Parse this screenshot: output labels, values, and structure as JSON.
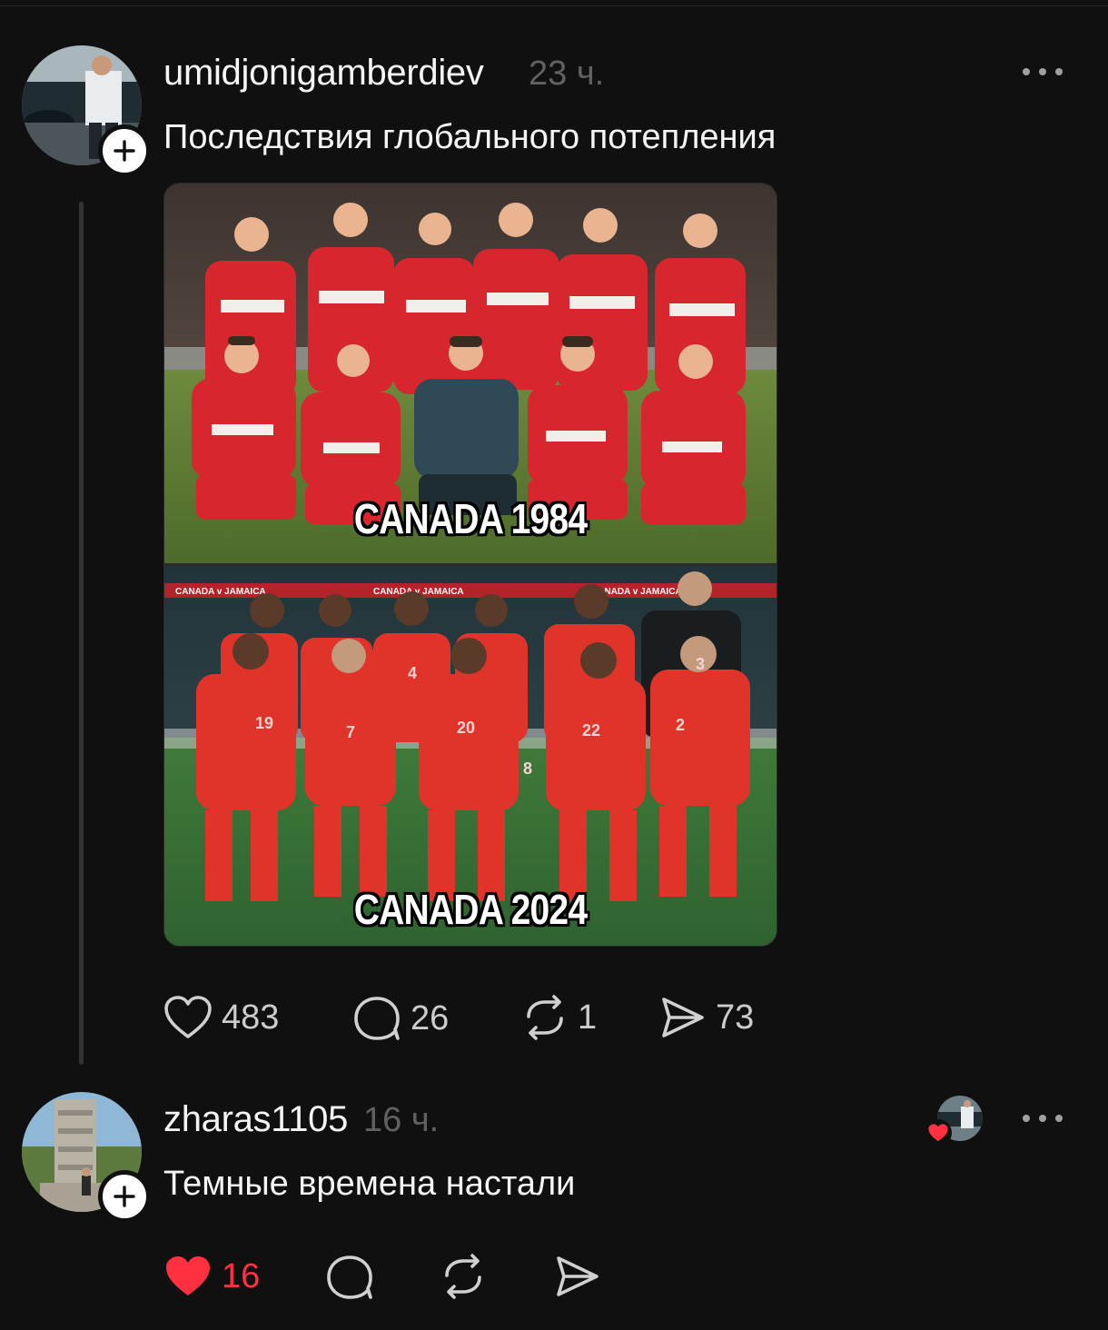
{
  "post": {
    "username": "umidjonigamberdiev",
    "time": "23 ч.",
    "text": "Последствия глобального потепления",
    "media": {
      "top_caption": "CANADA 1984",
      "bottom_caption": "CANADA 2024",
      "top_jersey_text": "canada",
      "banner_text": "CANADA v JAMAICA",
      "jersey_numbers": [
        "19",
        "7",
        "20",
        "22",
        "2",
        "4",
        "8",
        "3"
      ]
    },
    "actions": {
      "likes": "483",
      "comments": "26",
      "reposts": "1",
      "shares": "73"
    }
  },
  "reply": {
    "username": "zharas1105",
    "time": "16 ч.",
    "text": "Темные времена настали",
    "actions": {
      "likes": "16"
    }
  },
  "colors": {
    "background": "#101010",
    "text": "#f3f5f7",
    "muted": "#616161",
    "like_red": "#ff3040",
    "jersey_1984": "#d8262e",
    "jersey_2024": "#e0342a"
  },
  "icons": [
    "plus-icon",
    "more-icon",
    "heart-icon",
    "comment-icon",
    "repost-icon",
    "share-icon"
  ]
}
